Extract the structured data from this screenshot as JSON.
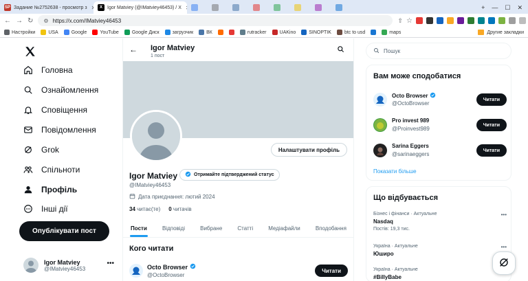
{
  "browser": {
    "tabs": [
      {
        "label": "Задание №2752638 - просмотр з",
        "favicon": "SP",
        "state": "inactive"
      },
      {
        "label": "Igor Matviey (@IMatviey46453) / X",
        "favicon": "X",
        "state": "active"
      }
    ],
    "url": "https://x.com/IMatviey46453",
    "bookmarks": [
      {
        "label": "Настройки",
        "color": "#5f6368"
      },
      {
        "label": "USA",
        "color": "#f1c40f"
      },
      {
        "label": "Google",
        "color": "#4285f4"
      },
      {
        "label": "YouTube",
        "color": "#ff0000"
      },
      {
        "label": "Google Диск",
        "color": "#0f9d58"
      },
      {
        "label": "загрузчик",
        "color": "#1e88e5"
      },
      {
        "label": "ВК",
        "color": "#4a76a8"
      },
      {
        "label": "",
        "color": "#ff6b00"
      },
      {
        "label": "",
        "color": "#e53935"
      },
      {
        "label": "rutracker",
        "color": "#607d8b"
      },
      {
        "label": "UAKino",
        "color": "#c62828"
      },
      {
        "label": "SINOPTIK",
        "color": "#1565c0"
      },
      {
        "label": "btc to usd",
        "color": "#6d4c41"
      },
      {
        "label": "",
        "color": "#1976d2"
      },
      {
        "label": "maps",
        "color": "#34a853"
      }
    ],
    "other_bookmarks": "Другие закладки"
  },
  "nav": {
    "items": [
      {
        "label": "Головна",
        "icon": "home-icon"
      },
      {
        "label": "Ознайомлення",
        "icon": "explore-icon"
      },
      {
        "label": "Сповіщення",
        "icon": "bell-icon"
      },
      {
        "label": "Повідомлення",
        "icon": "mail-icon"
      },
      {
        "label": "Grok",
        "icon": "grok-icon"
      },
      {
        "label": "Спільноти",
        "icon": "communities-icon"
      },
      {
        "label": "Профіль",
        "icon": "profile-icon"
      },
      {
        "label": "Інші дії",
        "icon": "more-icon"
      }
    ],
    "post_button": "Опублікувати пост",
    "account": {
      "name": "Igor Matviey",
      "handle": "@IMatviey46453"
    }
  },
  "profile": {
    "header_name": "Igor Matviey",
    "post_count": "1 пост",
    "edit_button": "Налаштувати профіль",
    "name": "Igor Matviey",
    "verify_chip": "Отримайте підтверджений статус",
    "handle": "@IMatviey46453",
    "joined": "Дата приєднання: лютий 2024",
    "following_count": "34",
    "following_label": "читає(те)",
    "followers_count": "0",
    "followers_label": "читачів",
    "tabs": [
      "Пости",
      "Відповіді",
      "Вибране",
      "Статті",
      "Медіафайли",
      "Вподобання"
    ],
    "who_to_follow": {
      "title": "Кого читати",
      "items": [
        {
          "name": "Octo Browser",
          "handle": "@OctoBrowser",
          "button": "Читати",
          "verified": true
        }
      ]
    }
  },
  "sidebar": {
    "search_placeholder": "Пошук",
    "suggestions_title": "Вам може сподобатися",
    "suggestions": [
      {
        "name": "Octo Browser",
        "handle": "@OctoBrowser",
        "button": "Читати",
        "verified": true
      },
      {
        "name": "Pro invest 989",
        "handle": "@Proinvest989",
        "button": "Читати",
        "verified": false
      },
      {
        "name": "Sarina Eggers",
        "handle": "@sarinaeggers",
        "button": "Читати",
        "verified": false
      }
    ],
    "show_more": "Показати більше",
    "trends_title": "Що відбувається",
    "trends": [
      {
        "meta": "Бізнес і фінанси · Актуальне",
        "title": "Nasdaq",
        "count": "Постів: 19,3 тис."
      },
      {
        "meta": "Україна · Актуальне",
        "title": "Юширо",
        "count": ""
      },
      {
        "meta": "Україна · Актуальне",
        "title": "#BillyBabe",
        "count": ""
      }
    ]
  },
  "colors": {
    "accent": "#1d9bf0",
    "text": "#0f1419",
    "muted": "#536471",
    "banner": "#cfd9de"
  }
}
